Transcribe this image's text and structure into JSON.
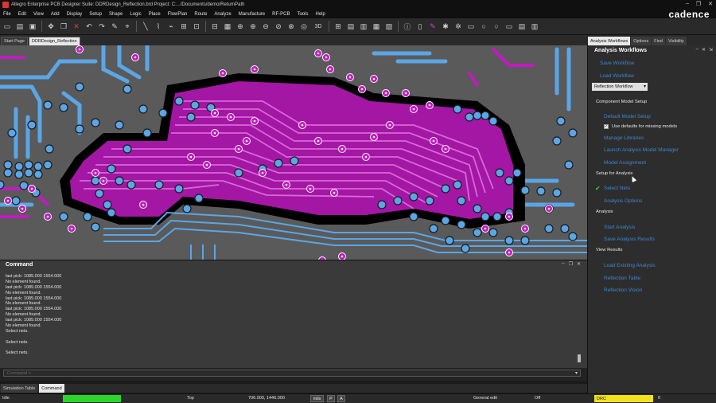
{
  "window": {
    "title": "Allegro Enterprise PCB Designer Suite: DDRDesign_Reflection.brd  Project: C:.../Documents/demo/ReturnPath",
    "controls": [
      "–",
      "❐",
      "✕"
    ],
    "brand": "cadence"
  },
  "menu": [
    "File",
    "Edit",
    "View",
    "Add",
    "Display",
    "Setup",
    "Shape",
    "Logic",
    "Place",
    "FlowPlan",
    "Route",
    "Analyze",
    "Manufacture",
    "RF-PCB",
    "Tools",
    "Help"
  ],
  "toolbar": {
    "icons": [
      "open-icon",
      "new-icon",
      "save-icon",
      "move-icon",
      "copy-icon",
      "delete-icon",
      "undo-icon",
      "redo-icon",
      "pin-icon",
      "probe-icon",
      "route-icon",
      "slide-icon",
      "text-icon",
      "grid-icon",
      "measure-icon",
      "zoom-fit-icon",
      "zoom-in-icon",
      "zoom-out-icon",
      "zoom-prev-icon",
      "zoom-window-icon",
      "redraw-icon",
      "3d-icon",
      "layers-icon",
      "shape-icon",
      "table-icon",
      "info-icon",
      "highlight-icon",
      "dehighlight-icon",
      "lightbulb-icon",
      "star-icon",
      "drc-icon",
      "circle-icon",
      "rect-icon",
      "report-icon",
      "check-icon"
    ],
    "zoom_3d_label": "3D"
  },
  "doc_tabs": [
    {
      "label": "Start Page",
      "active": false
    },
    {
      "label": "DDRDesign_Reflection",
      "active": true
    }
  ],
  "colors": {
    "board_bg": "#5a5a5a",
    "copper_magenta": "#c21ac2",
    "trace_blue": "#5aa6e6",
    "void_black": "#000000",
    "link_blue": "#3e86d0",
    "drc_yellow": "#f2e21b",
    "progress_green": "#2cd52c"
  },
  "command": {
    "title": "Command",
    "controls": [
      "–",
      "❐",
      "✕"
    ],
    "lines": [
      "last pick:  1085.000 1554.000",
      "No element found.",
      "last pick:  1085.000 1554.000",
      "No element found.",
      "last pick:  1085.000 1554.000",
      "No element found.",
      "last pick:  1085.000 1554.000",
      "No element found.",
      "last pick:  1085.000 1554.000",
      "No element found.",
      "Select nets.",
      "",
      "Select nets.",
      "",
      "Select nets."
    ],
    "input_placeholder": "Command >"
  },
  "bottom_tabs": [
    {
      "label": "Simulation Table",
      "active": false
    },
    {
      "label": "Command",
      "active": true
    }
  ],
  "status": {
    "state": "Idle",
    "layer": "Top",
    "coords": "706.000, 1446.000",
    "units": "mils",
    "p_button": "P",
    "a_button": "A",
    "mode": "General edit",
    "snap": "Off",
    "drc_label": "DRC",
    "drc_count": "0"
  },
  "right_panel": {
    "tabs": [
      {
        "label": "Analysis Workflows",
        "active": true
      },
      {
        "label": "Options",
        "active": false
      },
      {
        "label": "Find",
        "active": false
      },
      {
        "label": "Visibility",
        "active": false
      }
    ],
    "title": "Analysis Workflows",
    "controls": [
      "–",
      "✕",
      "⇲"
    ],
    "save_workflow": "Save Workflow",
    "load_workflow": "Load Workflow",
    "workflow_select": "Reflection Workflow",
    "sections": {
      "component_model_setup": "Component Model Setup",
      "setup_for_analysis": "Setup for Analysis",
      "analysis": "Analysis",
      "view_results": "View Results"
    },
    "default_model_setup": "Default Model Setup",
    "use_defaults_label": "Use defaults for missing models",
    "use_defaults_checked": true,
    "manage_libraries": "Manage Libraries",
    "launch_model_manager": "Launch Analysis Model Manager",
    "model_assignment": "Model Assignment",
    "select_nets": "Select Nets",
    "analysis_options": "Analysis Options",
    "start_analysis": "Start Analysis",
    "save_analysis_results": "Save Analysis Results",
    "load_existing_analysis": "Load Existing Analysis",
    "reflection_table": "Reflection Table",
    "reflection_vision": "Reflection Vision"
  }
}
